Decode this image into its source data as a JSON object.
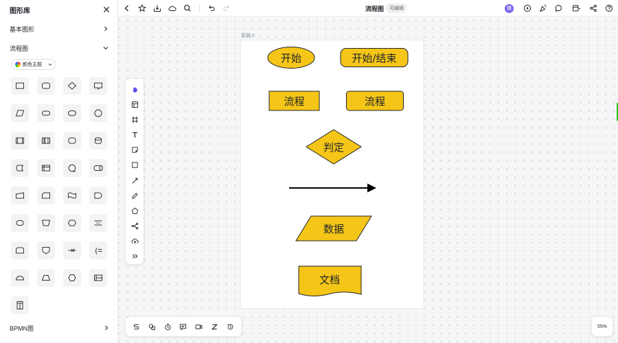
{
  "sidebar": {
    "title": "图形库",
    "sections": {
      "basic": "基本图形",
      "flowchart": "流程图",
      "bpmn": "BPMN图"
    },
    "theme_button": "颜色主题"
  },
  "topbar": {
    "title": "流程图",
    "edit_badge": "可编辑",
    "avatar_initial": "微"
  },
  "canvas": {
    "frame_label": "容器 6",
    "shapes": {
      "start": "开始",
      "start_end": "开始/结束",
      "process_1": "流程",
      "process_2": "流程",
      "decision": "判定",
      "data": "数据",
      "document": "文档"
    },
    "shape_fill": "#f5c518"
  },
  "zoom": "55%"
}
